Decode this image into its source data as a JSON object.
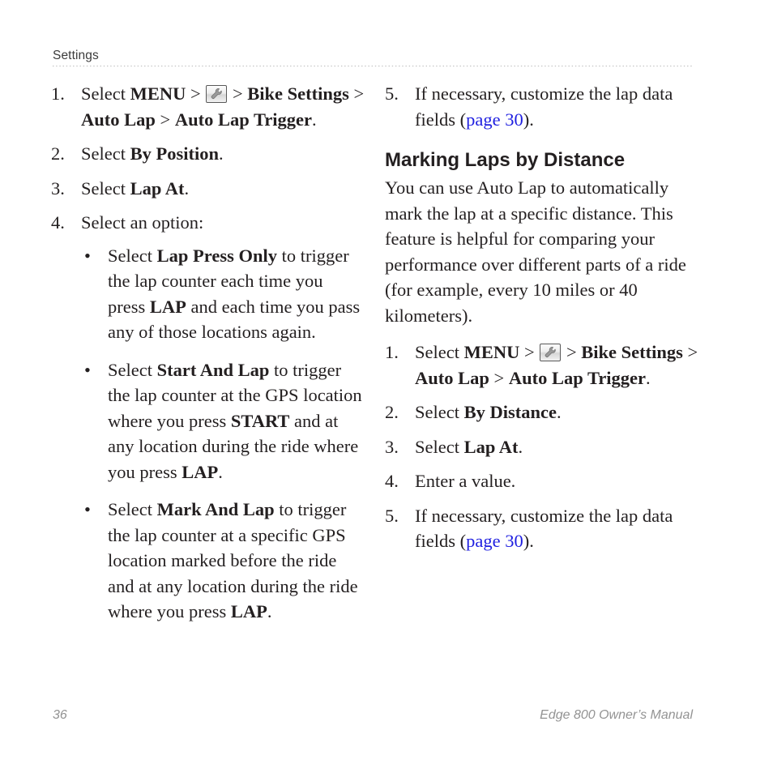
{
  "header": {
    "title": "Settings"
  },
  "icons": {
    "tools": "wrench-icon"
  },
  "left_column": {
    "steps": [
      {
        "num": "1.",
        "parts": [
          {
            "t": "Select ",
            "style": "normal"
          },
          {
            "t": "MENU",
            "style": "bold"
          },
          {
            "t": " > ",
            "style": "normal"
          },
          {
            "t": "",
            "style": "icon"
          },
          {
            "t": " > ",
            "style": "normal"
          },
          {
            "t": "Bike Settings",
            "style": "bold"
          },
          {
            "t": " > ",
            "style": "normal"
          },
          {
            "t": "Auto Lap",
            "style": "bold"
          },
          {
            "t": " > ",
            "style": "normal"
          },
          {
            "t": "Auto Lap Trigger",
            "style": "bold"
          },
          {
            "t": ".",
            "style": "normal"
          }
        ]
      },
      {
        "num": "2.",
        "parts": [
          {
            "t": "Select ",
            "style": "normal"
          },
          {
            "t": "By Position",
            "style": "bold"
          },
          {
            "t": ".",
            "style": "normal"
          }
        ]
      },
      {
        "num": "3.",
        "parts": [
          {
            "t": "Select ",
            "style": "normal"
          },
          {
            "t": "Lap At",
            "style": "bold"
          },
          {
            "t": ".",
            "style": "normal"
          }
        ]
      },
      {
        "num": "4.",
        "parts": [
          {
            "t": "Select an option:",
            "style": "normal"
          }
        ],
        "bullets": [
          {
            "marker": "•",
            "parts": [
              {
                "t": "Select ",
                "style": "normal"
              },
              {
                "t": "Lap Press Only",
                "style": "bold"
              },
              {
                "t": " to trigger the lap counter each time you press ",
                "style": "normal"
              },
              {
                "t": "LAP",
                "style": "bold"
              },
              {
                "t": " and each time you pass any of those locations again.",
                "style": "normal"
              }
            ]
          },
          {
            "marker": "•",
            "parts": [
              {
                "t": "Select ",
                "style": "normal"
              },
              {
                "t": "Start And Lap",
                "style": "bold"
              },
              {
                "t": " to trigger the lap counter at the GPS location where you press ",
                "style": "normal"
              },
              {
                "t": "START",
                "style": "bold"
              },
              {
                "t": " and at any location during the ride where you press ",
                "style": "normal"
              },
              {
                "t": "LAP",
                "style": "bold"
              },
              {
                "t": ".",
                "style": "normal"
              }
            ]
          },
          {
            "marker": "•",
            "parts": [
              {
                "t": "Select ",
                "style": "normal"
              },
              {
                "t": "Mark And Lap",
                "style": "bold"
              },
              {
                "t": " to trigger the lap counter at a specific GPS location marked before the ride and at any location during the ride where you press ",
                "style": "normal"
              },
              {
                "t": "LAP",
                "style": "bold"
              },
              {
                "t": ".",
                "style": "normal"
              }
            ]
          }
        ]
      }
    ]
  },
  "right_column": {
    "continued_step": {
      "num": "5.",
      "parts": [
        {
          "t": "If necessary, customize the lap data fields (",
          "style": "normal"
        },
        {
          "t": "page 30",
          "style": "link"
        },
        {
          "t": ").",
          "style": "normal"
        }
      ]
    },
    "heading": "Marking Laps by Distance",
    "paragraph": "You can use Auto Lap to automatically mark the lap at a specific distance. This feature is helpful for comparing your performance over different parts of a ride (for example, every 10 miles or 40 kilometers).",
    "steps": [
      {
        "num": "1.",
        "parts": [
          {
            "t": "Select ",
            "style": "normal"
          },
          {
            "t": "MENU",
            "style": "bold"
          },
          {
            "t": " > ",
            "style": "normal"
          },
          {
            "t": "",
            "style": "icon"
          },
          {
            "t": " > ",
            "style": "normal"
          },
          {
            "t": "Bike Settings",
            "style": "bold"
          },
          {
            "t": " > ",
            "style": "normal"
          },
          {
            "t": "Auto Lap",
            "style": "bold"
          },
          {
            "t": " > ",
            "style": "normal"
          },
          {
            "t": "Auto Lap Trigger",
            "style": "bold"
          },
          {
            "t": ".",
            "style": "normal"
          }
        ]
      },
      {
        "num": "2.",
        "parts": [
          {
            "t": "Select ",
            "style": "normal"
          },
          {
            "t": "By Distance",
            "style": "bold"
          },
          {
            "t": ".",
            "style": "normal"
          }
        ]
      },
      {
        "num": "3.",
        "parts": [
          {
            "t": "Select ",
            "style": "normal"
          },
          {
            "t": "Lap At",
            "style": "bold"
          },
          {
            "t": ".",
            "style": "normal"
          }
        ]
      },
      {
        "num": "4.",
        "parts": [
          {
            "t": "Enter a value.",
            "style": "normal"
          }
        ]
      },
      {
        "num": "5.",
        "parts": [
          {
            "t": "If necessary, customize the lap data fields (",
            "style": "normal"
          },
          {
            "t": "page 30",
            "style": "link"
          },
          {
            "t": ").",
            "style": "normal"
          }
        ]
      }
    ]
  },
  "footer": {
    "page_number": "36",
    "manual_title": "Edge 800 Owner’s Manual"
  },
  "colors": {
    "link": "#1f1fe0",
    "text": "#231f20",
    "footer": "#939393",
    "header": "#3b3b3b"
  }
}
